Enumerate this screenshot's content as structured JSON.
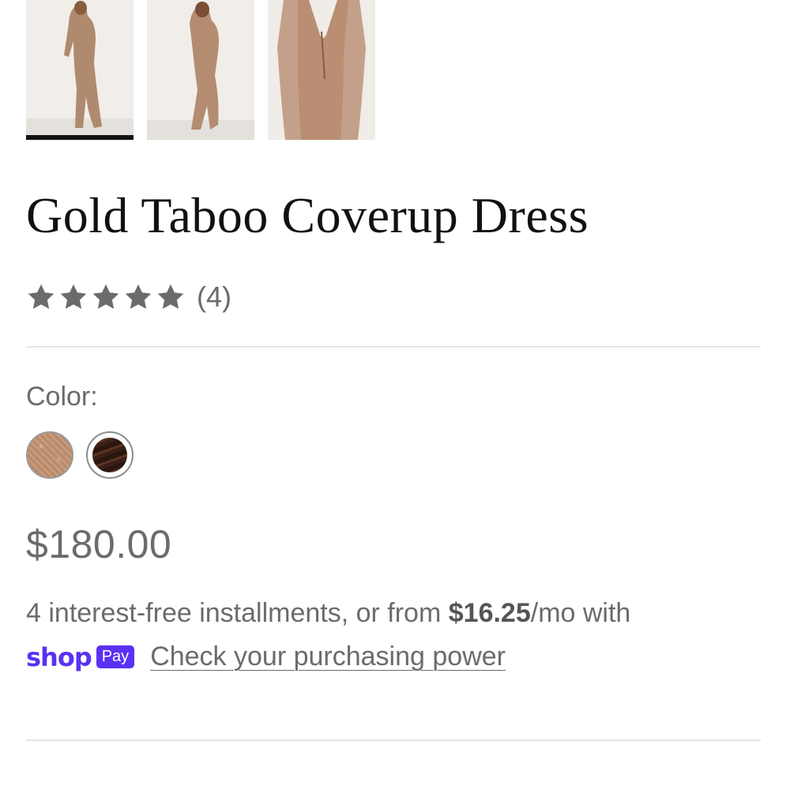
{
  "gallery": {
    "thumbnails": [
      {
        "name": "front view",
        "active": true
      },
      {
        "name": "side view",
        "active": false
      },
      {
        "name": "close-up view",
        "active": false
      }
    ]
  },
  "product": {
    "title": "Gold Taboo Coverup Dress",
    "rating": {
      "stars": 5,
      "count_label": "(4)",
      "star_icon": "star-icon",
      "star_color": "#6b6b6b"
    },
    "color": {
      "label": "Color:",
      "swatches": [
        {
          "name": "gold",
          "color": "#c29676",
          "selected": false
        },
        {
          "name": "brown",
          "color": "#3a2015",
          "selected": true
        }
      ]
    },
    "price": "$180.00",
    "installments": {
      "prefix": "4 interest-free installments, or from ",
      "amount": "$16.25",
      "suffix": "/mo with"
    },
    "shop_pay": {
      "shop_word": "shop",
      "pay_badge": "Pay",
      "link_label": "Check your purchasing power",
      "brand_color": "#5a31f4"
    }
  }
}
